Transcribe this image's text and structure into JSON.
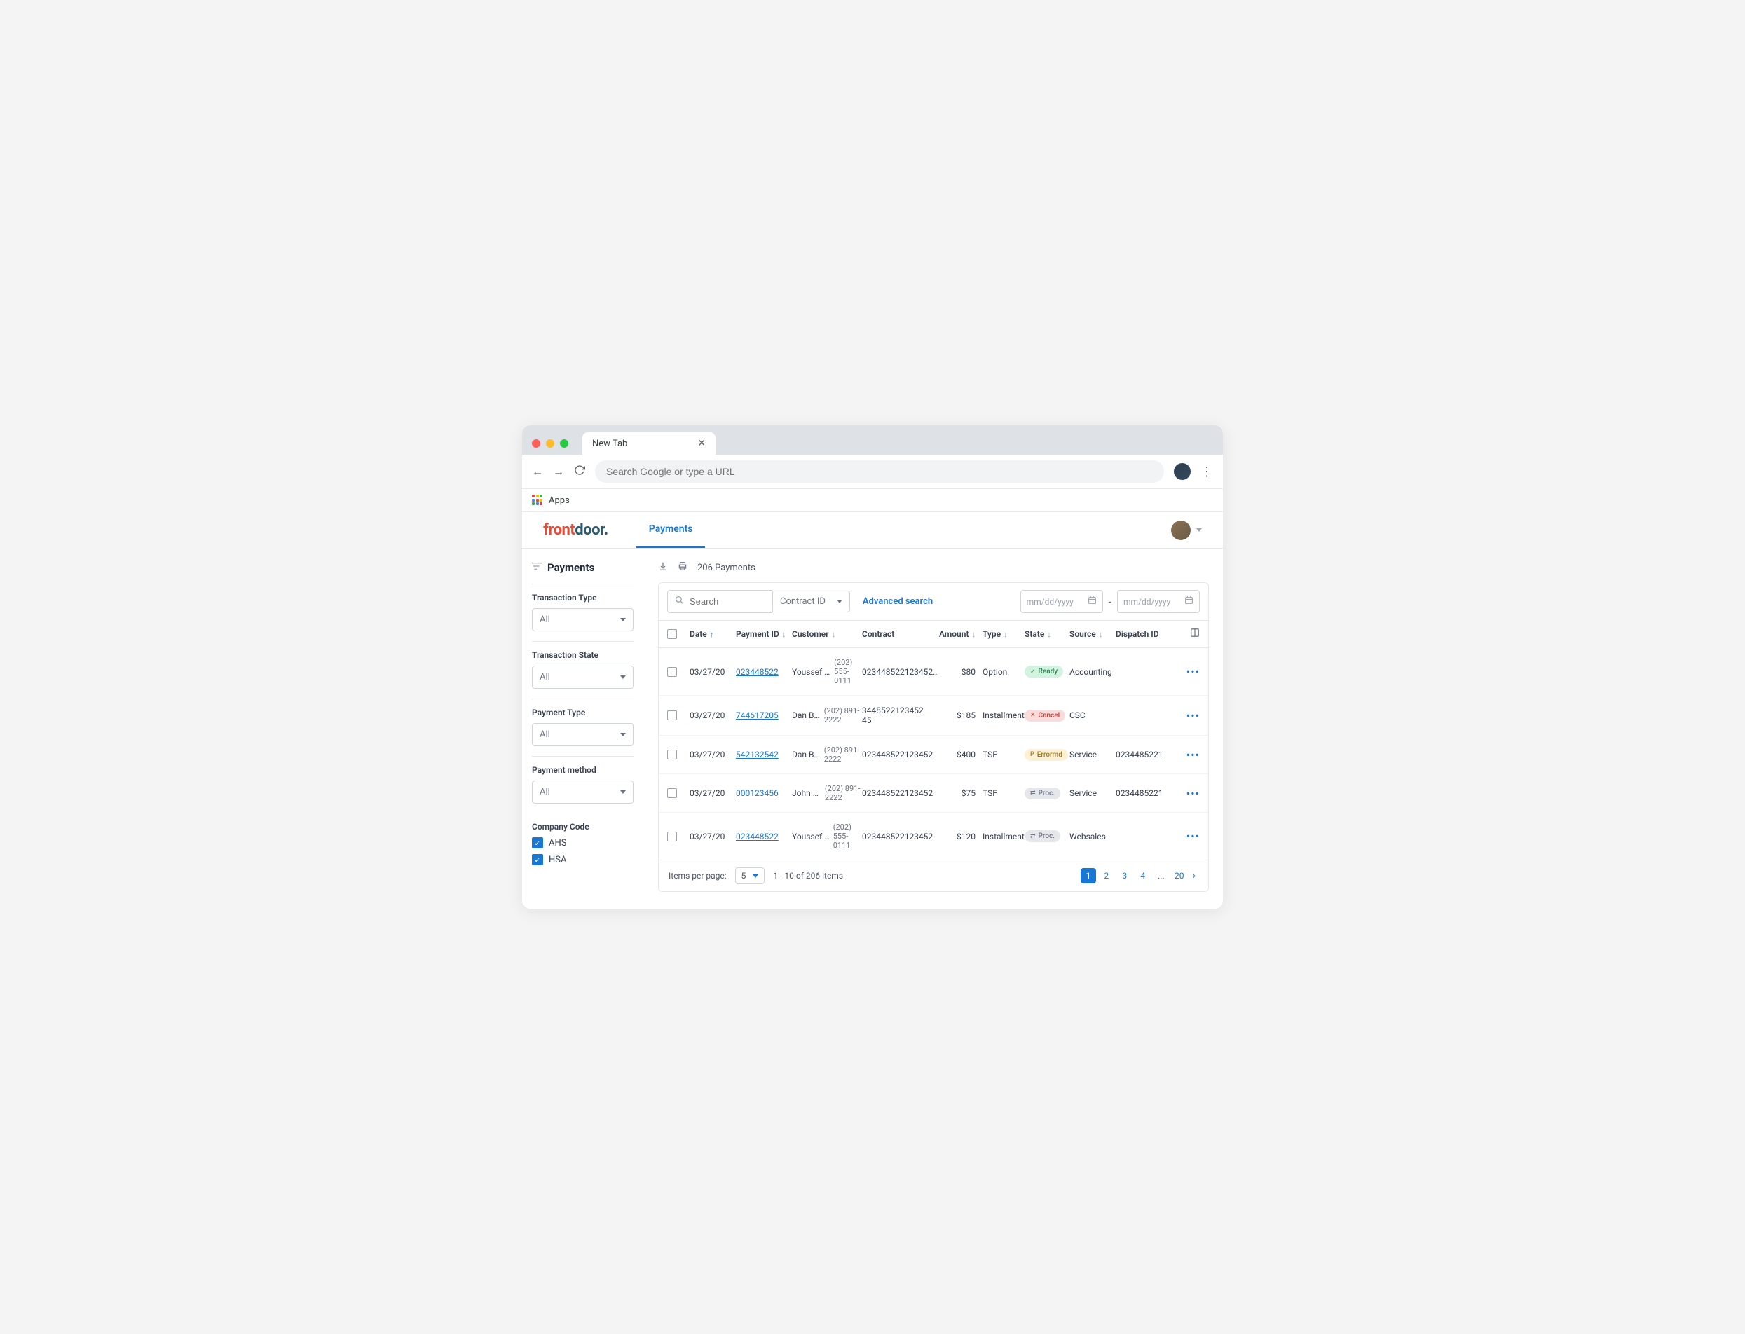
{
  "browser": {
    "tab_title": "New Tab",
    "address_placeholder": "Search Google or type a URL",
    "bookmarks_label": "Apps"
  },
  "logo_text": "frontdoor",
  "nav": {
    "payments": "Payments"
  },
  "sidebar": {
    "title": "Payments",
    "filters": {
      "txn_type": {
        "label": "Transaction Type",
        "value": "All"
      },
      "txn_state": {
        "label": "Transaction State",
        "value": "All"
      },
      "pay_type": {
        "label": "Payment Type",
        "value": "All"
      },
      "pay_method": {
        "label": "Payment method",
        "value": "All"
      }
    },
    "company_code": {
      "label": "Company Code",
      "ahs": "AHS",
      "hsa": "HSA"
    }
  },
  "toolbar": {
    "count_text": "206 Payments"
  },
  "search": {
    "placeholder": "Search",
    "contract_label": "Contract ID",
    "advanced": "Advanced search",
    "date_placeholder": "mm/dd/yyyy",
    "date_sep": "-"
  },
  "columns": {
    "date": "Date",
    "payment_id": "Payment ID",
    "customer": "Customer",
    "contract": "Contract",
    "amount": "Amount",
    "type": "Type",
    "state": "State",
    "source": "Source",
    "dispatch_id": "Dispatch ID"
  },
  "rows": [
    {
      "date": "03/27/20",
      "payment_id": "023448522",
      "customer": "Youssef & Yolanda..",
      "phone": "(202) 555-0111",
      "contract": "023448522123452..",
      "amount": "$80",
      "type": "Option",
      "state": {
        "kind": "ready",
        "label": "Ready",
        "icon": "✓"
      },
      "source": "Accounting",
      "dispatch": ""
    },
    {
      "date": "03/27/20",
      "payment_id": "744617205",
      "customer": "Dan Brown",
      "phone": "(202) 891-2222",
      "contract": "3448522123452​45",
      "amount": "$185",
      "type": "Installment",
      "state": {
        "kind": "cancel",
        "label": "Cancel",
        "icon": "✕"
      },
      "source": "CSC",
      "dispatch": ""
    },
    {
      "date": "03/27/20",
      "payment_id": "542132542",
      "customer": "Dan Brown",
      "phone": "(202) 891-2222",
      "contract": "023448522123452",
      "amount": "$400",
      "type": "TSF",
      "state": {
        "kind": "error",
        "label": "Errormd",
        "icon": "P"
      },
      "source": "Service",
      "dispatch": "0234485221"
    },
    {
      "date": "03/27/20",
      "payment_id": "000123456",
      "customer": "John Smith",
      "phone": "(202) 891-2222",
      "contract": "023448522123452",
      "amount": "$75",
      "type": "TSF",
      "state": {
        "kind": "proc",
        "label": "Proc.",
        "icon": "⇄"
      },
      "source": "Service",
      "dispatch": "0234485221"
    },
    {
      "date": "03/27/20",
      "payment_id": "023448522",
      "customer": "Youssef & Yolanda",
      "phone": "(202) 555-0111",
      "contract": "023448522123452",
      "amount": "$120",
      "type": "Installment",
      "state": {
        "kind": "proc",
        "label": "Proc.",
        "icon": "⇄"
      },
      "source": "Websales",
      "dispatch": ""
    }
  ],
  "pagination": {
    "per_page_label": "Items per page:",
    "per_page_value": "5",
    "range_text": "1 - 10 of 206 items",
    "pages": [
      "1",
      "2",
      "3",
      "4",
      "...",
      "20"
    ]
  }
}
